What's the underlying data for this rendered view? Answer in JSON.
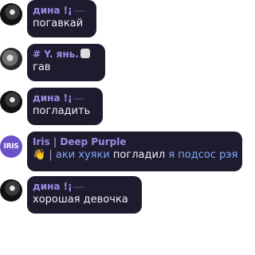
{
  "messages": [
    {
      "author": "дина !¡",
      "text": "погавкай"
    },
    {
      "author": "# Y. янь.",
      "text": "гав"
    },
    {
      "author": "дина !¡",
      "text": "погладить"
    },
    {
      "author": "Iris | Deep Purple",
      "avatar_text": "IRIS",
      "emoji": "👋",
      "separator": "|",
      "segments": [
        "аки хуяки",
        " погладил ",
        "я подсос рэя"
      ]
    },
    {
      "author": "дина !¡",
      "text": "хорошая девочка"
    }
  ],
  "colors": {
    "bubble": "#1f1b2e",
    "author": "#9b8ee6",
    "text": "#f1eef8",
    "mention": "#7fa6f5"
  }
}
